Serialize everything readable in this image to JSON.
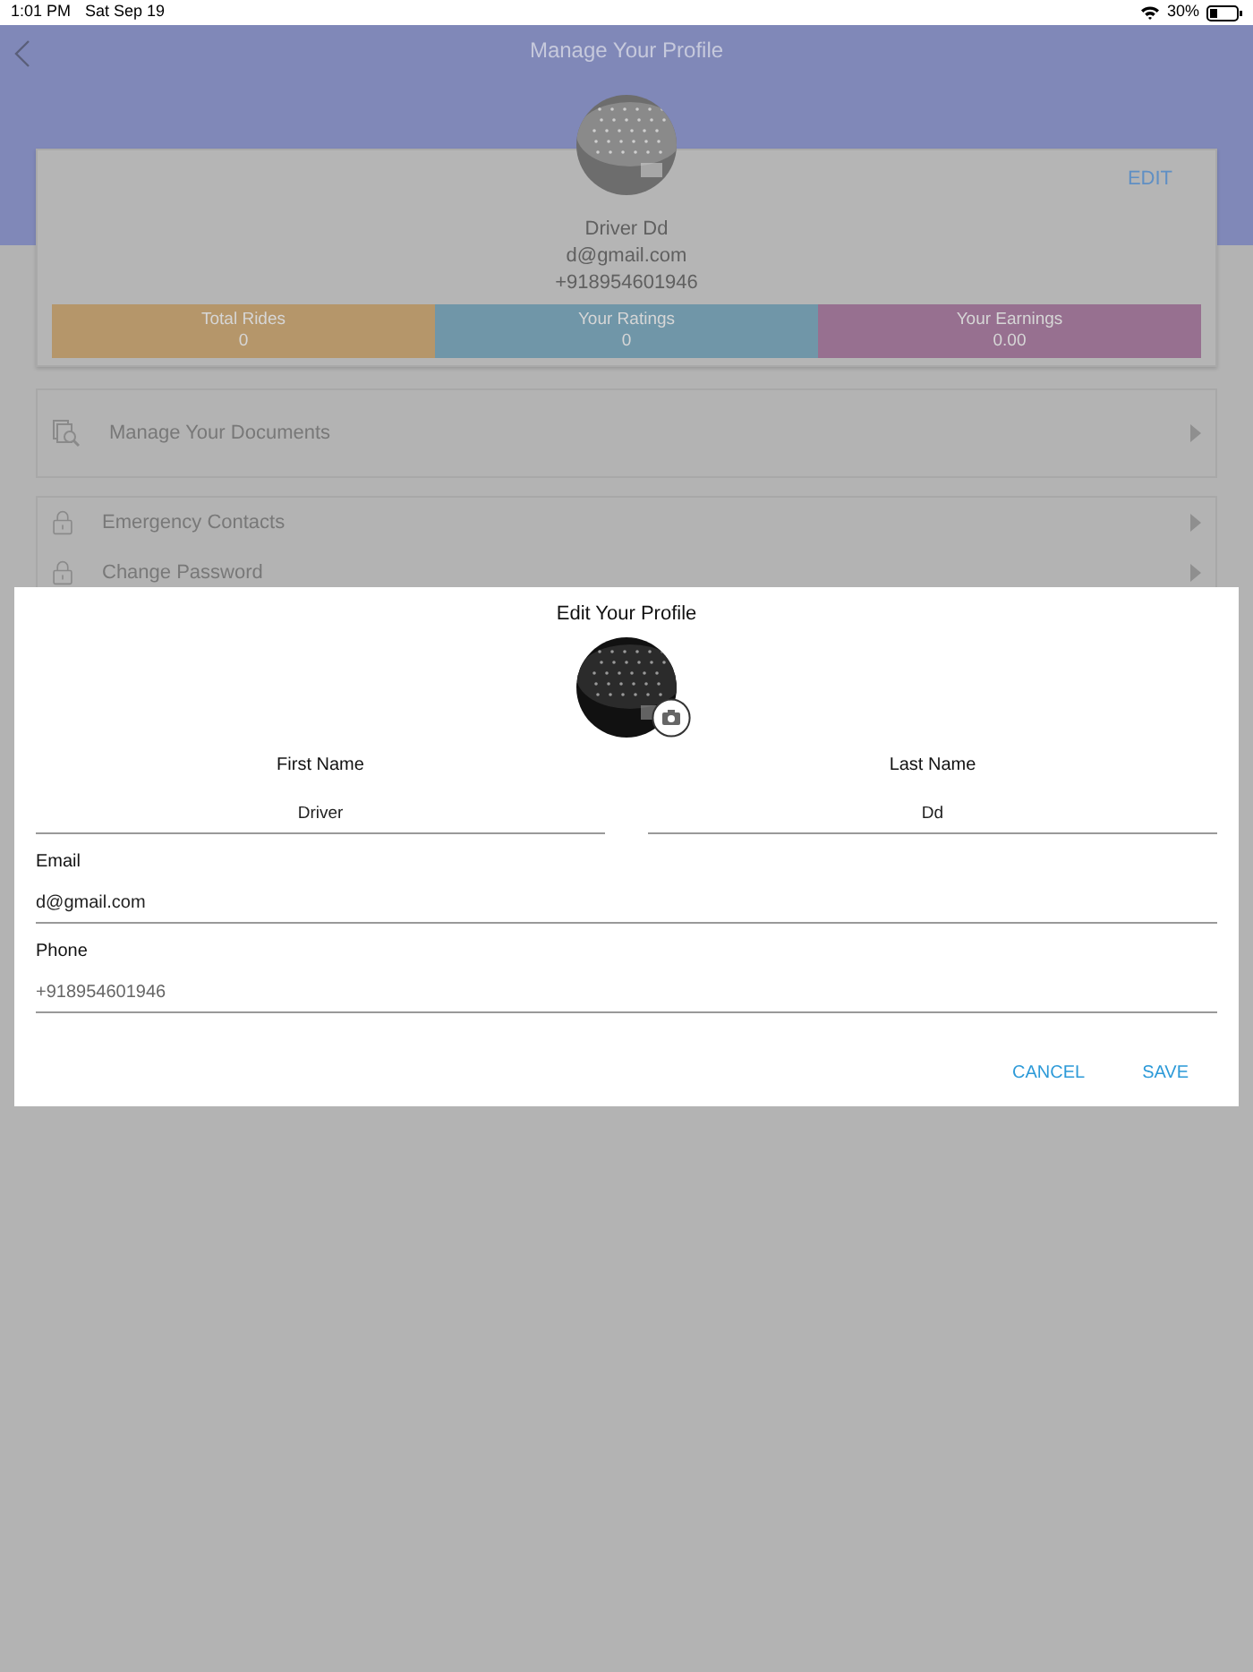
{
  "status_bar": {
    "time": "1:01 PM",
    "date": "Sat Sep 19",
    "battery": "30%"
  },
  "header": {
    "title": "Manage Your Profile"
  },
  "profile": {
    "edit": "EDIT",
    "name": "Driver Dd",
    "email": "d@gmail.com",
    "phone": "+918954601946"
  },
  "stats": [
    {
      "label": "Total Rides",
      "value": "0",
      "color": "#b5966a"
    },
    {
      "label": "Your Ratings",
      "value": "0",
      "color": "#7096a8"
    },
    {
      "label": "Your Earnings",
      "value": "0.00",
      "color": "#977090"
    }
  ],
  "menu_groups": [
    [
      {
        "kind": "documents",
        "label": "Manage Your Documents"
      }
    ],
    [
      {
        "kind": "lock",
        "label": "Emergency Contacts"
      },
      {
        "kind": "lock",
        "label": "Change Password"
      }
    ]
  ],
  "dialog": {
    "title": "Edit Your Profile",
    "name_fields": [
      {
        "label": "First Name",
        "value": "Driver"
      },
      {
        "label": "Last Name",
        "value": "Dd"
      }
    ],
    "fields": [
      {
        "label": "Email",
        "value": "d@gmail.com",
        "disabled": false
      },
      {
        "label": "Phone",
        "value": "+918954601946",
        "disabled": true
      }
    ],
    "buttons": [
      "CANCEL",
      "SAVE"
    ]
  }
}
